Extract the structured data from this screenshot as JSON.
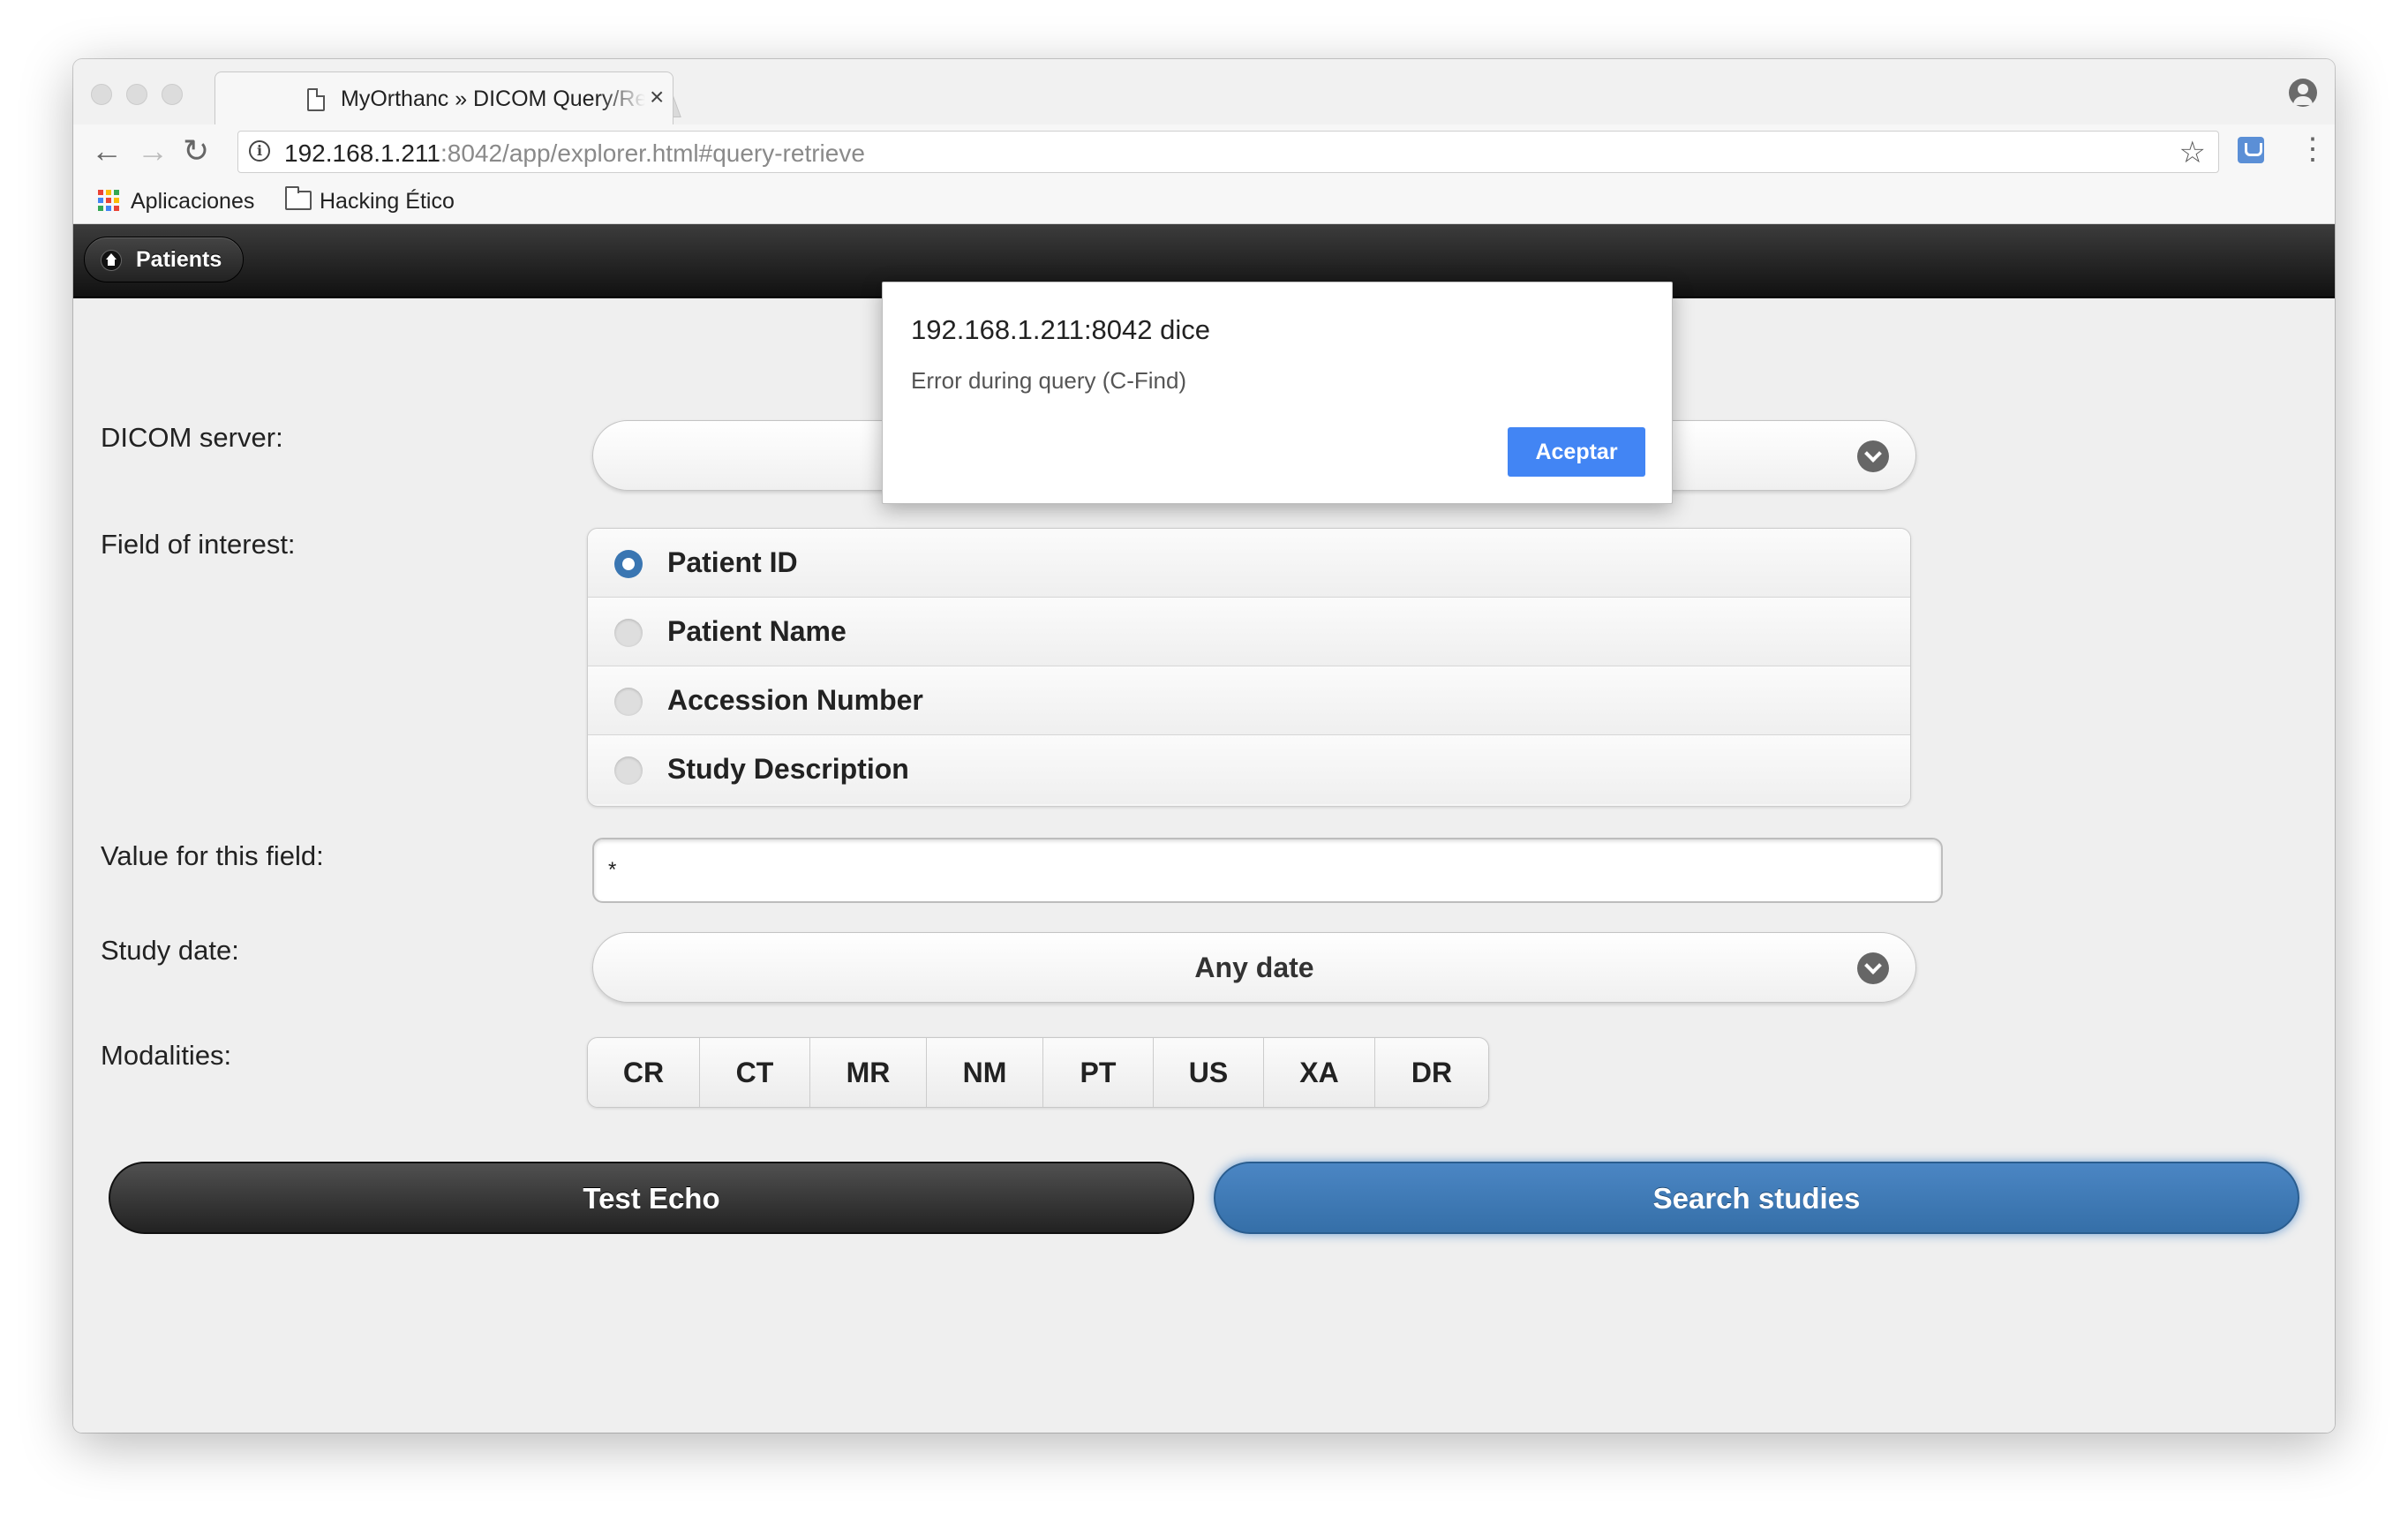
{
  "browser": {
    "tab_title": "MyOrthanc » DICOM Query/Re",
    "tab_close": "×",
    "url_host": "192.168.1.211",
    "url_rest": ":8042/app/explorer.html#query-retrieve",
    "nav": {
      "back": "←",
      "forward": "→",
      "reload": "↻",
      "star": "☆",
      "menu": "⋮"
    },
    "bookmarks": [
      {
        "label": "Aplicaciones",
        "icon": "apps-grid-icon"
      },
      {
        "label": "Hacking Ético",
        "icon": "folder-icon"
      }
    ]
  },
  "header": {
    "home_label": "Patients"
  },
  "form": {
    "dicom_server_label": "DICOM server:",
    "dicom_server_value": "",
    "field_label": "Field of interest:",
    "fields": [
      {
        "label": "Patient ID",
        "selected": true
      },
      {
        "label": "Patient Name",
        "selected": false
      },
      {
        "label": "Accession Number",
        "selected": false
      },
      {
        "label": "Study Description",
        "selected": false
      }
    ],
    "value_label": "Value for this field:",
    "value": "*",
    "study_date_label": "Study date:",
    "study_date_value": "Any date",
    "modalities_label": "Modalities:",
    "modalities": [
      "CR",
      "CT",
      "MR",
      "NM",
      "PT",
      "US",
      "XA",
      "DR"
    ]
  },
  "buttons": {
    "test_echo": "Test Echo",
    "search": "Search studies"
  },
  "dialog": {
    "title": "192.168.1.211:8042 dice",
    "message": "Error during query (C-Find)",
    "ok_label": "Aceptar"
  },
  "colors": {
    "accent_blue": "#3a76b2",
    "dialog_button": "#4285f4",
    "header_dark": "#1a1a1a"
  }
}
